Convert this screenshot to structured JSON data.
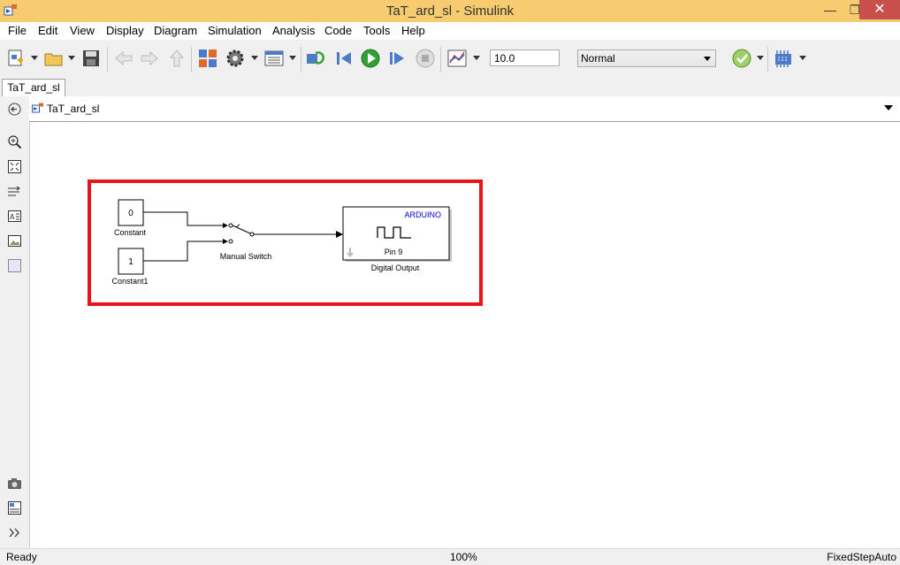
{
  "window": {
    "title": "TaT_ard_sl - Simulink"
  },
  "menu": [
    "File",
    "Edit",
    "View",
    "Display",
    "Diagram",
    "Simulation",
    "Analysis",
    "Code",
    "Tools",
    "Help"
  ],
  "toolbar": {
    "stop_time": "10.0",
    "sim_mode": "Normal"
  },
  "tab": {
    "label": "TaT_ard_sl"
  },
  "address": {
    "path": "TaT_ard_sl"
  },
  "diagram": {
    "constant0": {
      "value": "0",
      "name": "Constant"
    },
    "constant1": {
      "value": "1",
      "name": "Constant1"
    },
    "switch": {
      "name": "Manual Switch"
    },
    "digital_output": {
      "header": "ARDUINO",
      "pin": "Pin 9",
      "name": "Digital Output"
    }
  },
  "status": {
    "left": "Ready",
    "zoom": "100%",
    "solver": "FixedStepAuto"
  },
  "colors": {
    "titlebar": "#f7cb6f",
    "highlight": "#e8141a",
    "arduino_text": "#0000cc"
  }
}
